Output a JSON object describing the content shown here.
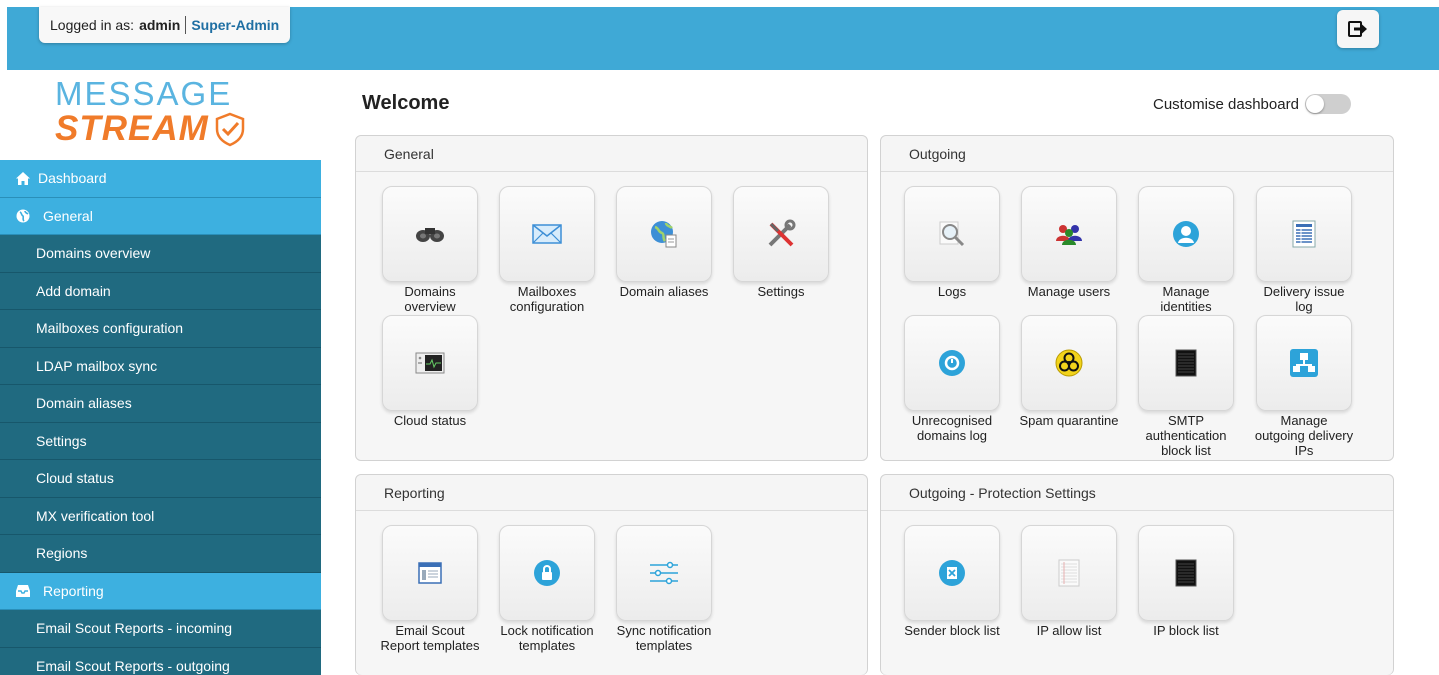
{
  "header": {
    "logged_in_label": "Logged in as:",
    "username": "admin",
    "role": "Super-Admin",
    "logout_icon": "logout-icon"
  },
  "logo": {
    "line1": "MESSAGE",
    "line2": "STREAM"
  },
  "sidebar": {
    "items": [
      {
        "label": "Dashboard",
        "type": "section",
        "icon": "home-icon"
      },
      {
        "label": "General",
        "type": "section",
        "icon": "globe-icon"
      },
      {
        "label": "Domains overview",
        "type": "sub"
      },
      {
        "label": "Add domain",
        "type": "sub"
      },
      {
        "label": "Mailboxes configuration",
        "type": "sub"
      },
      {
        "label": "LDAP mailbox sync",
        "type": "sub"
      },
      {
        "label": "Domain aliases",
        "type": "sub"
      },
      {
        "label": "Settings",
        "type": "sub"
      },
      {
        "label": "Cloud status",
        "type": "sub"
      },
      {
        "label": "MX verification tool",
        "type": "sub"
      },
      {
        "label": "Regions",
        "type": "sub"
      },
      {
        "label": "Reporting",
        "type": "section",
        "icon": "inbox-icon"
      },
      {
        "label": "Email Scout Reports - incoming",
        "type": "sub"
      },
      {
        "label": "Email Scout Reports - outgoing",
        "type": "sub"
      }
    ]
  },
  "main": {
    "title": "Welcome",
    "customise_label": "Customise dashboard",
    "customise_on": false,
    "panels": {
      "general": {
        "title": "General",
        "tiles": [
          {
            "label": "Domains overview",
            "icon": "binoculars-icon"
          },
          {
            "label": "Mailboxes configuration",
            "icon": "envelope-icon"
          },
          {
            "label": "Domain aliases",
            "icon": "globe-document-icon"
          },
          {
            "label": "Settings",
            "icon": "tools-icon"
          },
          {
            "label": "Cloud status",
            "icon": "monitor-icon"
          }
        ]
      },
      "outgoing": {
        "title": "Outgoing",
        "tiles": [
          {
            "label": "Logs",
            "icon": "magnifier-icon"
          },
          {
            "label": "Manage users",
            "icon": "users-icon"
          },
          {
            "label": "Manage identities",
            "icon": "identity-icon"
          },
          {
            "label": "Delivery issue log",
            "icon": "report-icon"
          },
          {
            "label": "Unrecognised domains log",
            "icon": "clock-icon"
          },
          {
            "label": "Spam quarantine",
            "icon": "biohazard-icon"
          },
          {
            "label": "SMTP authentication block list",
            "icon": "blocklist-icon"
          },
          {
            "label": "Manage outgoing delivery IPs",
            "icon": "network-icon"
          }
        ]
      },
      "reporting": {
        "title": "Reporting",
        "tiles": [
          {
            "label": "Email Scout Report templates",
            "icon": "template-icon"
          },
          {
            "label": "Lock notification templates",
            "icon": "lock-icon"
          },
          {
            "label": "Sync notification templates",
            "icon": "sliders-icon"
          }
        ]
      },
      "protection": {
        "title": "Outgoing - Protection Settings",
        "tiles": [
          {
            "label": "Sender block list",
            "icon": "sender-block-icon"
          },
          {
            "label": "IP allow list",
            "icon": "allow-list-icon"
          },
          {
            "label": "IP block list",
            "icon": "blocklist-icon"
          }
        ]
      }
    }
  },
  "colors": {
    "topbar": "#3fa9d6",
    "nav_section": "#3db0e0",
    "nav_sub": "#206a80",
    "logo_blue": "#5ab4e0",
    "logo_orange": "#f07b2a"
  }
}
